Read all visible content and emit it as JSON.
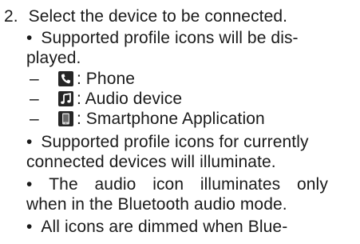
{
  "step": {
    "number": "2.",
    "text": "Select the device to be connected."
  },
  "bullets": [
    {
      "symbol": "•",
      "line1": "Supported profile icons will be dis-",
      "line2": "played."
    },
    {
      "symbol": "•",
      "line1": "Supported profile icons for currently",
      "line2": "connected devices will illuminate."
    },
    {
      "symbol": "•",
      "line1_words": [
        "The",
        "audio",
        "icon",
        "illuminates",
        "only"
      ],
      "line2": "when in the Bluetooth audio mode."
    },
    {
      "symbol": "•",
      "line1": "All icons are dimmed when Blue-"
    }
  ],
  "profiles": [
    {
      "dash": "–",
      "icon": "phone-icon",
      "label": ": Phone"
    },
    {
      "dash": "–",
      "icon": "music-note-icon",
      "label": ": Audio device"
    },
    {
      "dash": "–",
      "icon": "smartphone-icon",
      "label": ": Smartphone Application"
    }
  ]
}
